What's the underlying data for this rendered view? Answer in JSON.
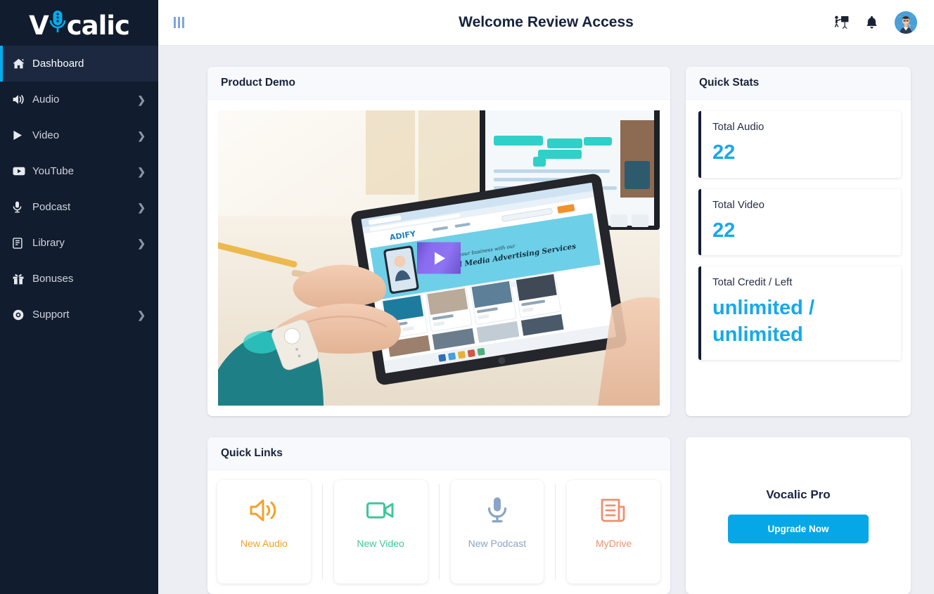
{
  "brand": {
    "name": "Vocalic",
    "name_part1": "V",
    "name_part2": "calic",
    "logo_icon": "microphone-icon",
    "accent_color": "#00aeef"
  },
  "sidebar": {
    "items": [
      {
        "label": "Dashboard",
        "icon": "home-icon",
        "active": true,
        "has_chevron": false
      },
      {
        "label": "Audio",
        "icon": "volume-up-icon",
        "active": false,
        "has_chevron": true
      },
      {
        "label": "Video",
        "icon": "play-icon",
        "active": false,
        "has_chevron": true
      },
      {
        "label": "YouTube",
        "icon": "youtube-icon",
        "active": false,
        "has_chevron": true
      },
      {
        "label": "Podcast",
        "icon": "microphone-icon",
        "active": false,
        "has_chevron": true
      },
      {
        "label": "Library",
        "icon": "book-icon",
        "active": false,
        "has_chevron": true
      },
      {
        "label": "Bonuses",
        "icon": "gift-icon",
        "active": false,
        "has_chevron": false
      },
      {
        "label": "Support",
        "icon": "life-ring-icon",
        "active": false,
        "has_chevron": true
      }
    ],
    "chevron_glyph": "❯"
  },
  "topbar": {
    "menu_toggle_icon": "sidebar-toggle-icon",
    "title": "Welcome Review Access",
    "training_icon": "presentation-training-icon",
    "notification_icon": "bell-icon",
    "avatar_icon": "user-avatar"
  },
  "product_demo": {
    "title": "Product Demo",
    "play_icon": "play-button-icon",
    "thumbnail_alt": "hands holding a tablet showing the ADIFY social media advertising website"
  },
  "quick_stats": {
    "title": "Quick Stats",
    "items": [
      {
        "label": "Total Audio",
        "value": "22"
      },
      {
        "label": "Total Video",
        "value": "22"
      },
      {
        "label": "Total Credit / Left",
        "value": "unlimited / unlimited"
      }
    ],
    "value_color": "#16a9e8",
    "accent_bar_color": "#121d32"
  },
  "quick_links": {
    "title": "Quick Links",
    "items": [
      {
        "label": "New Audio",
        "icon": "volume-up-icon",
        "color": "#f5a02a"
      },
      {
        "label": "New Video",
        "icon": "video-camera-icon",
        "color": "#3ec79a"
      },
      {
        "label": "New Podcast",
        "icon": "microphone-icon",
        "color": "#8aa4c8"
      },
      {
        "label": "MyDrive",
        "icon": "newspaper-icon",
        "color": "#ef9070"
      }
    ]
  },
  "upgrade": {
    "title": "Vocalic Pro",
    "button_label": "Upgrade Now",
    "button_color": "#06a7e6"
  }
}
